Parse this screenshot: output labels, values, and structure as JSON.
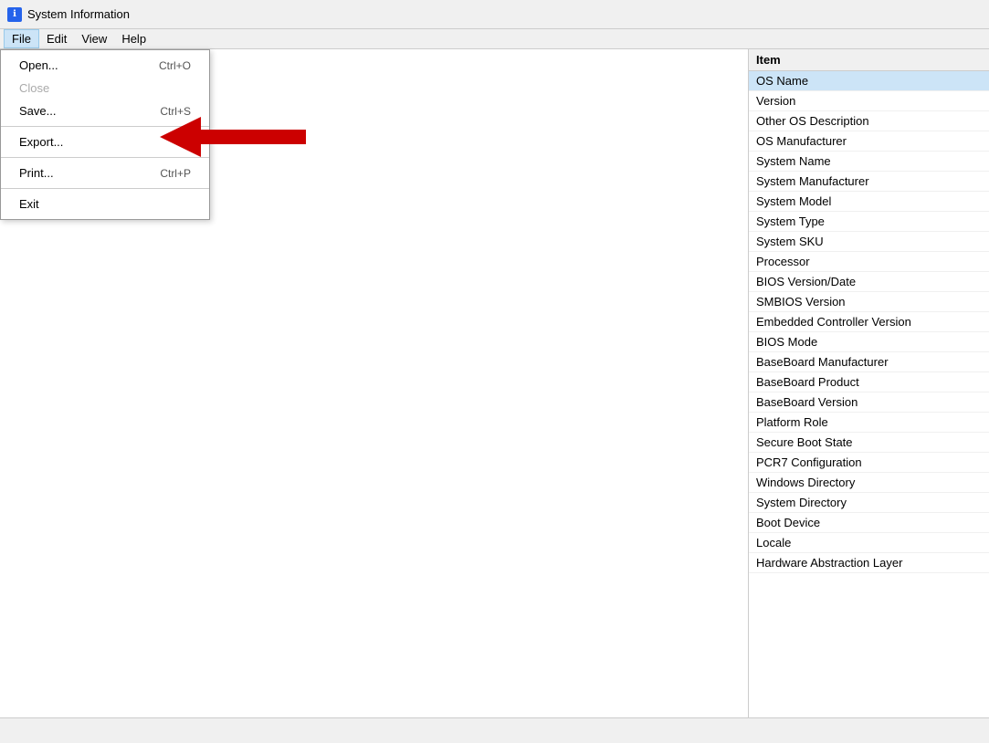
{
  "titleBar": {
    "icon": "ℹ",
    "title": "System Information"
  },
  "menuBar": {
    "items": [
      {
        "id": "file",
        "label": "File",
        "active": true
      },
      {
        "id": "edit",
        "label": "Edit"
      },
      {
        "id": "view",
        "label": "View"
      },
      {
        "id": "help",
        "label": "Help"
      }
    ]
  },
  "fileMenu": {
    "items": [
      {
        "id": "open",
        "label": "Open...",
        "shortcut": "Ctrl+O",
        "disabled": false
      },
      {
        "id": "close",
        "label": "Close",
        "shortcut": "",
        "disabled": true
      },
      {
        "id": "save",
        "label": "Save...",
        "shortcut": "Ctrl+S",
        "disabled": false
      },
      {
        "id": "sep1",
        "type": "separator"
      },
      {
        "id": "export",
        "label": "Export...",
        "shortcut": "",
        "disabled": false
      },
      {
        "id": "sep2",
        "type": "separator"
      },
      {
        "id": "print",
        "label": "Print...",
        "shortcut": "Ctrl+P",
        "disabled": false
      },
      {
        "id": "sep3",
        "type": "separator"
      },
      {
        "id": "exit",
        "label": "Exit",
        "shortcut": "",
        "disabled": false
      }
    ]
  },
  "rightPane": {
    "header": "Item",
    "rows": [
      {
        "id": "os-name",
        "label": "OS Name",
        "selected": true
      },
      {
        "id": "version",
        "label": "Version",
        "selected": false
      },
      {
        "id": "other-os-desc",
        "label": "Other OS Description",
        "selected": false
      },
      {
        "id": "os-manufacturer",
        "label": "OS Manufacturer",
        "selected": false
      },
      {
        "id": "system-name",
        "label": "System Name",
        "selected": false
      },
      {
        "id": "system-manufacturer",
        "label": "System Manufacturer",
        "selected": false
      },
      {
        "id": "system-model",
        "label": "System Model",
        "selected": false
      },
      {
        "id": "system-type",
        "label": "System Type",
        "selected": false
      },
      {
        "id": "system-sku",
        "label": "System SKU",
        "selected": false
      },
      {
        "id": "processor",
        "label": "Processor",
        "selected": false
      },
      {
        "id": "bios-version",
        "label": "BIOS Version/Date",
        "selected": false
      },
      {
        "id": "smbios-version",
        "label": "SMBIOS Version",
        "selected": false
      },
      {
        "id": "embedded-controller",
        "label": "Embedded Controller Version",
        "selected": false
      },
      {
        "id": "bios-mode",
        "label": "BIOS Mode",
        "selected": false
      },
      {
        "id": "baseboard-manufacturer",
        "label": "BaseBoard Manufacturer",
        "selected": false
      },
      {
        "id": "baseboard-product",
        "label": "BaseBoard Product",
        "selected": false
      },
      {
        "id": "baseboard-version",
        "label": "BaseBoard Version",
        "selected": false
      },
      {
        "id": "platform-role",
        "label": "Platform Role",
        "selected": false
      },
      {
        "id": "secure-boot-state",
        "label": "Secure Boot State",
        "selected": false
      },
      {
        "id": "pcr7-config",
        "label": "PCR7 Configuration",
        "selected": false
      },
      {
        "id": "windows-directory",
        "label": "Windows Directory",
        "selected": false
      },
      {
        "id": "system-directory",
        "label": "System Directory",
        "selected": false
      },
      {
        "id": "boot-device",
        "label": "Boot Device",
        "selected": false
      },
      {
        "id": "locale",
        "label": "Locale",
        "selected": false
      },
      {
        "id": "hardware-abstraction-layer",
        "label": "Hardware Abstraction Layer",
        "selected": false
      }
    ]
  },
  "statusBar": {
    "text": ""
  }
}
